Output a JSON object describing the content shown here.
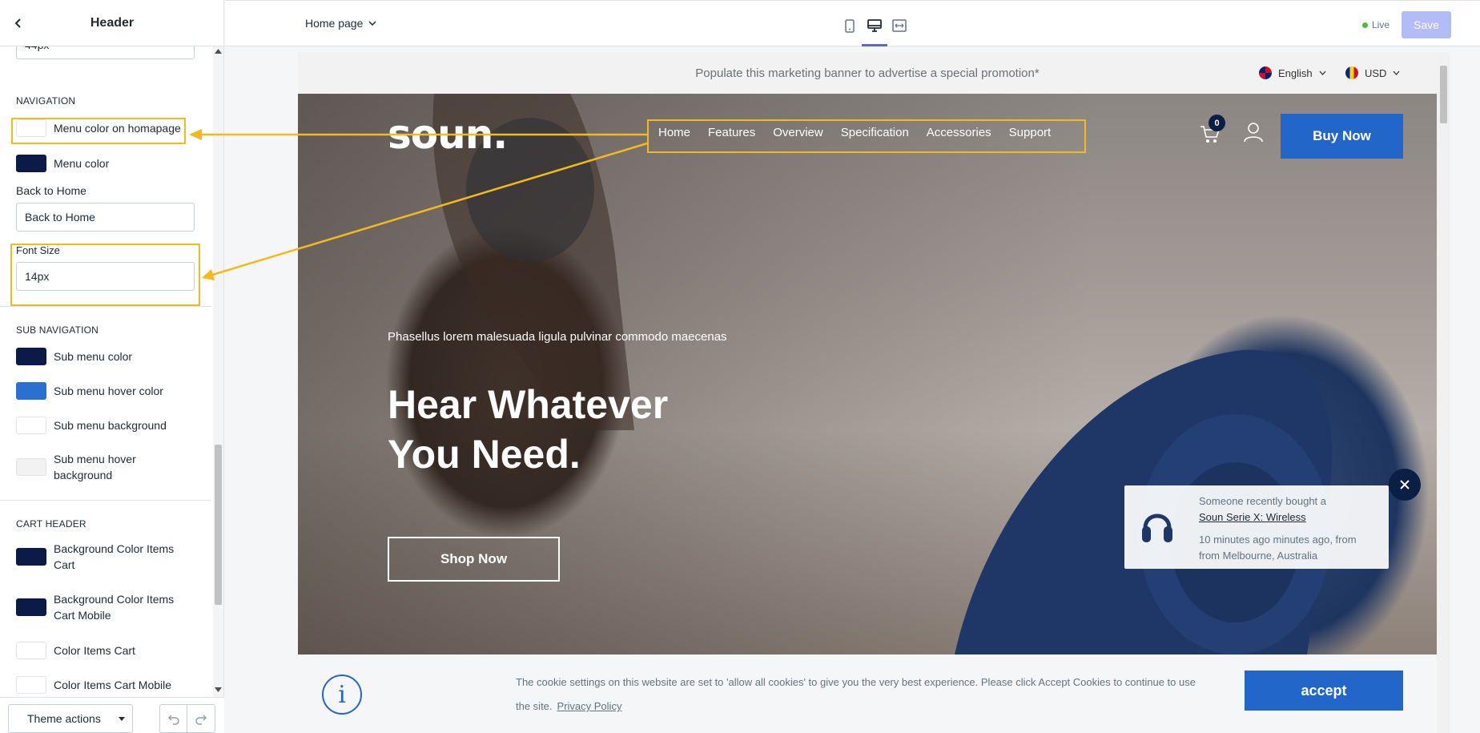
{
  "sidebar": {
    "title": "Header",
    "height_value": "44px",
    "nav_section": "NAVIGATION",
    "menu_color_homepage": "Menu color on homapage",
    "menu_color": "Menu color",
    "back_to_home_label": "Back to Home",
    "back_to_home_value": "Back to Home",
    "font_size_label": "Font Size",
    "font_size_value": "14px",
    "subnav_section": "SUB NAVIGATION",
    "sub_menu_color": "Sub menu color",
    "sub_menu_hover_color": "Sub menu hover color",
    "sub_menu_background": "Sub menu background",
    "sub_menu_hover_bg_1": "Sub menu hover",
    "sub_menu_hover_bg_2": "background",
    "cart_section": "CART HEADER",
    "bg_items_cart_1": "Background Color Items",
    "bg_items_cart_2": "Cart",
    "bg_items_cart_mobile_1": "Background Color Items",
    "bg_items_cart_mobile_2": "Cart Mobile",
    "color_items_cart": "Color Items Cart",
    "color_items_cart_mobile": "Color Items Cart Mobile",
    "theme_actions": "Theme actions",
    "swatches": {
      "menu_color_homepage": "#ffffff",
      "menu_color": "#0b1a47",
      "sub_menu_color": "#0b1a47",
      "sub_menu_hover_color": "#2970cf",
      "sub_menu_background": "#ffffff",
      "sub_menu_hover_background": "#f2f2f2",
      "bg_items_cart": "#0b1a47",
      "bg_items_cart_mobile": "#0b1a47",
      "color_items_cart": "#ffffff",
      "color_items_cart_mobile": "#ffffff"
    }
  },
  "topbar": {
    "page": "Home page",
    "live": "Live",
    "save": "Save",
    "devices": [
      "mobile-icon",
      "desktop-icon",
      "fullwidth-icon"
    ]
  },
  "preview": {
    "banner": "Populate this marketing banner to advertise a special promotion*",
    "language": "English",
    "currency": "USD",
    "logo": "soun.",
    "nav": [
      "Home",
      "Features",
      "Overview",
      "Specification",
      "Accessories",
      "Support"
    ],
    "cart_count": "0",
    "buy_now": "Buy Now",
    "hero_subtitle": "Phasellus lorem malesuada ligula pulvinar commodo maecenas",
    "hero_title": "Hear Whatever You Need.",
    "shop_now": "Shop Now",
    "toast": {
      "line1": "Someone recently bought a",
      "product": "Soun Serie X: Wireless",
      "line3": "10 minutes ago minutes ago, from from Melbourne, Australia"
    },
    "cookie": {
      "text": "The cookie settings on this website are set to 'allow all cookies' to give you the very best experience. Please click Accept Cookies to continue to use the site.",
      "link": "Privacy Policy",
      "accept": "accept"
    }
  },
  "colors": {
    "accent": "#2366c9",
    "annotation": "#f2bb1b",
    "navy": "#0b1f44"
  }
}
